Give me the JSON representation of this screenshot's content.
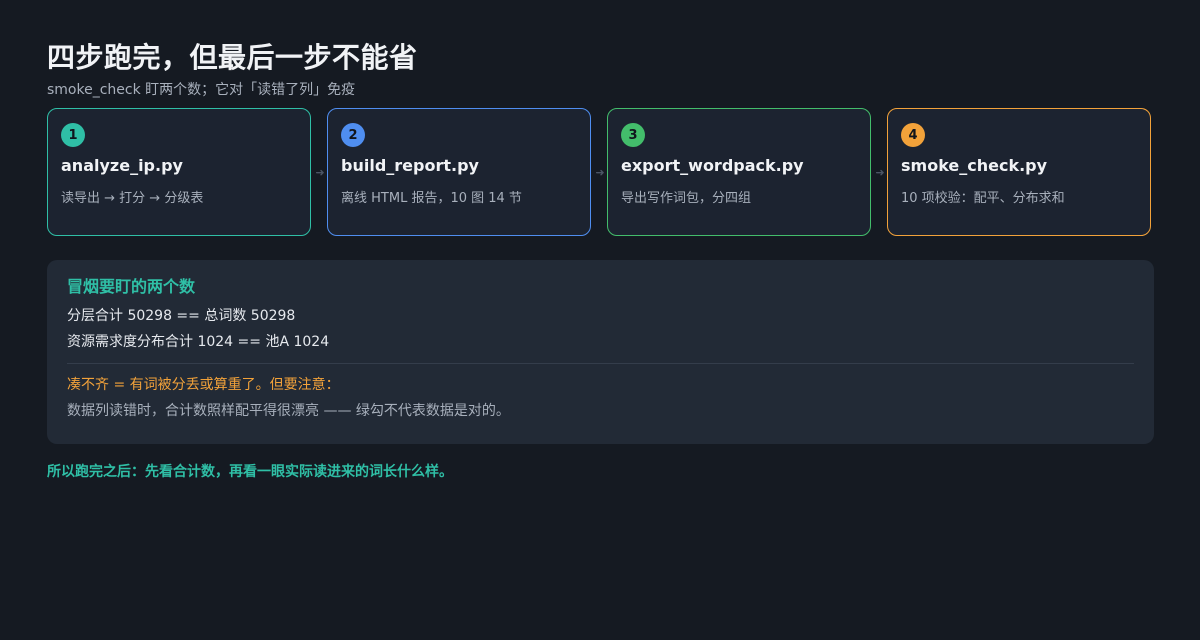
{
  "header": {
    "title": "四步跑完，但最后一步不能省",
    "subtitle": "smoke_check 盯两个数；它对「读错了列」免疫"
  },
  "steps": [
    {
      "number": "1",
      "name": "analyze_ip.py",
      "desc": "读导出 → 打分 → 分级表",
      "color": "#2fbfa6"
    },
    {
      "number": "2",
      "name": "build_report.py",
      "desc": "离线 HTML 报告，10 图 14 节",
      "color": "#4f8ef0"
    },
    {
      "number": "3",
      "name": "export_wordpack.py",
      "desc": "导出写作词包，分四组",
      "color": "#43bd6b"
    },
    {
      "number": "4",
      "name": "smoke_check.py",
      "desc": "10 项校验：配平、分布求和",
      "color": "#f2a23a"
    }
  ],
  "panel": {
    "title": "冒烟要盯的两个数",
    "lines": [
      "分层合计 50298 == 总词数 50298",
      "资源需求度分布合计 1024 == 池A 1024"
    ],
    "warning": "凑不齐 = 有词被分丢或算重了。但要注意：",
    "note": "数据列读错时，合计数照样配平得很漂亮 —— 绿勾不代表数据是对的。"
  },
  "conclusion": "所以跑完之后：先看合计数，再看一眼实际读进来的词长什么样。"
}
